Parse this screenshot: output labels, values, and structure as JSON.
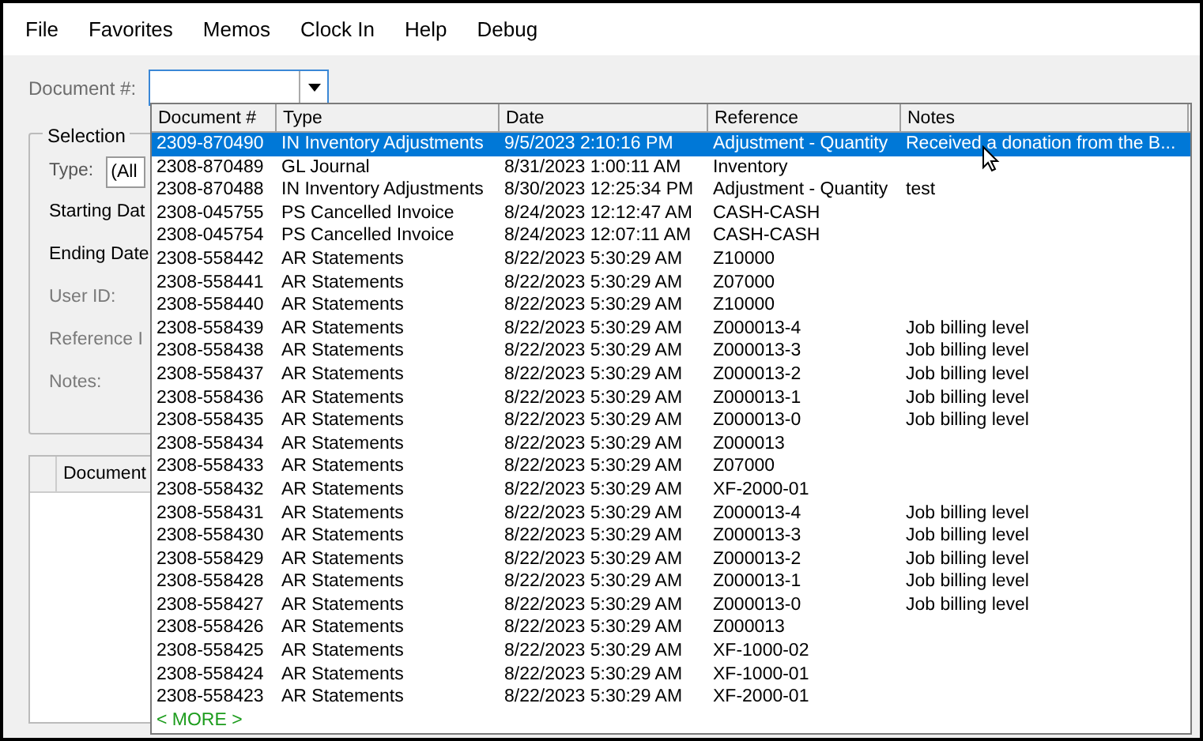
{
  "menu": [
    "File",
    "Favorites",
    "Memos",
    "Clock In",
    "Help",
    "Debug"
  ],
  "document_field": {
    "label": "Document #:"
  },
  "selection": {
    "title": "Selection",
    "type_label": "Type:",
    "type_value": "(All",
    "labels": [
      "Starting Dat",
      "Ending Date",
      "User ID:",
      "Reference I",
      "Notes:"
    ]
  },
  "grid": {
    "columns": [
      "Document"
    ]
  },
  "dropdown": {
    "columns": [
      "Document #",
      "Type",
      "Date",
      "Reference",
      "Notes"
    ],
    "rows": [
      {
        "cells": [
          "2309-870490",
          "IN Inventory Adjustments",
          "9/5/2023 2:10:16 PM",
          "Adjustment - Quantity",
          "Received a donation from the B..."
        ],
        "selected": true
      },
      {
        "cells": [
          "2308-870489",
          "GL Journal",
          "8/31/2023 1:00:11 AM",
          "Inventory",
          ""
        ],
        "selected": false
      },
      {
        "cells": [
          "2308-870488",
          "IN Inventory Adjustments",
          "8/30/2023 12:25:34 PM",
          "Adjustment - Quantity",
          "test"
        ],
        "selected": false
      },
      {
        "cells": [
          "2308-045755",
          "PS Cancelled Invoice",
          "8/24/2023 12:12:47 AM",
          "CASH-CASH",
          ""
        ],
        "selected": false
      },
      {
        "cells": [
          "2308-045754",
          "PS Cancelled Invoice",
          "8/24/2023 12:07:11 AM",
          "CASH-CASH",
          ""
        ],
        "selected": false
      },
      {
        "cells": [
          "2308-558442",
          "AR Statements",
          "8/22/2023 5:30:29 AM",
          "Z10000",
          ""
        ],
        "selected": false
      },
      {
        "cells": [
          "2308-558441",
          "AR Statements",
          "8/22/2023 5:30:29 AM",
          "Z07000",
          ""
        ],
        "selected": false
      },
      {
        "cells": [
          "2308-558440",
          "AR Statements",
          "8/22/2023 5:30:29 AM",
          "Z10000",
          ""
        ],
        "selected": false
      },
      {
        "cells": [
          "2308-558439",
          "AR Statements",
          "8/22/2023 5:30:29 AM",
          "Z000013-4",
          "Job billing level"
        ],
        "selected": false
      },
      {
        "cells": [
          "2308-558438",
          "AR Statements",
          "8/22/2023 5:30:29 AM",
          "Z000013-3",
          "Job billing level"
        ],
        "selected": false
      },
      {
        "cells": [
          "2308-558437",
          "AR Statements",
          "8/22/2023 5:30:29 AM",
          "Z000013-2",
          "Job billing level"
        ],
        "selected": false
      },
      {
        "cells": [
          "2308-558436",
          "AR Statements",
          "8/22/2023 5:30:29 AM",
          "Z000013-1",
          "Job billing level"
        ],
        "selected": false
      },
      {
        "cells": [
          "2308-558435",
          "AR Statements",
          "8/22/2023 5:30:29 AM",
          "Z000013-0",
          "Job billing level"
        ],
        "selected": false
      },
      {
        "cells": [
          "2308-558434",
          "AR Statements",
          "8/22/2023 5:30:29 AM",
          "Z000013",
          ""
        ],
        "selected": false
      },
      {
        "cells": [
          "2308-558433",
          "AR Statements",
          "8/22/2023 5:30:29 AM",
          "Z07000",
          ""
        ],
        "selected": false
      },
      {
        "cells": [
          "2308-558432",
          "AR Statements",
          "8/22/2023 5:30:29 AM",
          "XF-2000-01",
          ""
        ],
        "selected": false
      },
      {
        "cells": [
          "2308-558431",
          "AR Statements",
          "8/22/2023 5:30:29 AM",
          "Z000013-4",
          "Job billing level"
        ],
        "selected": false
      },
      {
        "cells": [
          "2308-558430",
          "AR Statements",
          "8/22/2023 5:30:29 AM",
          "Z000013-3",
          "Job billing level"
        ],
        "selected": false
      },
      {
        "cells": [
          "2308-558429",
          "AR Statements",
          "8/22/2023 5:30:29 AM",
          "Z000013-2",
          "Job billing level"
        ],
        "selected": false
      },
      {
        "cells": [
          "2308-558428",
          "AR Statements",
          "8/22/2023 5:30:29 AM",
          "Z000013-1",
          "Job billing level"
        ],
        "selected": false
      },
      {
        "cells": [
          "2308-558427",
          "AR Statements",
          "8/22/2023 5:30:29 AM",
          "Z000013-0",
          "Job billing level"
        ],
        "selected": false
      },
      {
        "cells": [
          "2308-558426",
          "AR Statements",
          "8/22/2023 5:30:29 AM",
          "Z000013",
          ""
        ],
        "selected": false
      },
      {
        "cells": [
          "2308-558425",
          "AR Statements",
          "8/22/2023 5:30:29 AM",
          "XF-1000-02",
          ""
        ],
        "selected": false
      },
      {
        "cells": [
          "2308-558424",
          "AR Statements",
          "8/22/2023 5:30:29 AM",
          "XF-1000-01",
          ""
        ],
        "selected": false
      },
      {
        "cells": [
          "2308-558423",
          "AR Statements",
          "8/22/2023 5:30:29 AM",
          "XF-2000-01",
          ""
        ],
        "selected": false
      }
    ],
    "more": "< MORE >"
  }
}
